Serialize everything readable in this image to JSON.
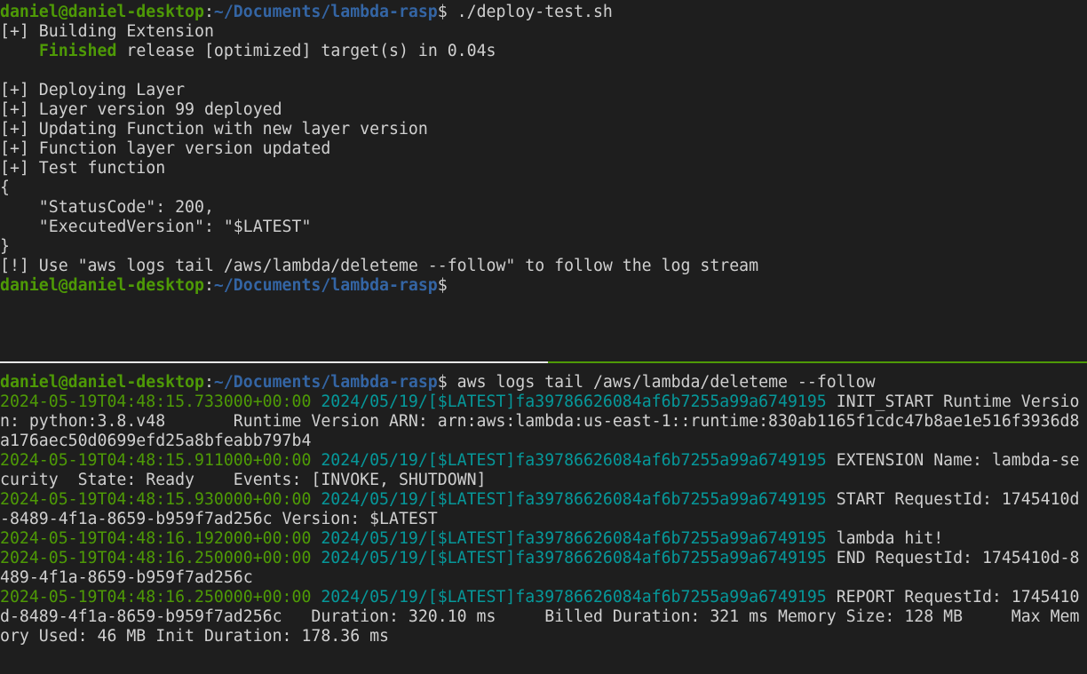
{
  "colors": {
    "background": "#1e1e1e",
    "foreground": "#d0d0d0",
    "prompt_user": "#4e9a06",
    "prompt_path": "#3465a4",
    "timestamp": "#4e9a06",
    "log_stream": "#06989a",
    "divider_inactive": "#e6e6e6",
    "divider_active": "#4e9a06"
  },
  "top": {
    "prompt_user": "daniel@daniel-desktop",
    "prompt_sep": ":",
    "prompt_path": "~/Documents/lambda-rasp",
    "prompt_dollar": "$ ",
    "command": "./deploy-test.sh",
    "l1": "[+] Building Extension",
    "finished_indent": "    ",
    "finished_word": "Finished",
    "finished_rest": " release [optimized] target(s) in 0.04s",
    "l3": "",
    "l4": "[+] Deploying Layer",
    "l5": "[+] Layer version 99 deployed",
    "l6": "[+] Updating Function with new layer version",
    "l7": "[+] Function layer version updated",
    "l8": "[+] Test function",
    "l9": "{",
    "l10": "    \"StatusCode\": 200,",
    "l11": "    \"ExecutedVersion\": \"$LATEST\"",
    "l12": "}",
    "l13": "[!] Use \"aws logs tail /aws/lambda/deleteme --follow\" to follow the log stream",
    "prompt2_dollar": "$"
  },
  "bottom": {
    "prompt_user": "daniel@daniel-desktop",
    "prompt_sep": ":",
    "prompt_path": "~/Documents/lambda-rasp",
    "prompt_dollar": "$ ",
    "command": "aws logs tail /aws/lambda/deleteme --follow",
    "stream": "2024/05/19/[$LATEST]fa39786626084af6b7255a99a6749195",
    "logs": [
      {
        "ts": "2024-05-19T04:48:15.733000+00:00",
        "msg_first": " INIT_START Runtime Versio",
        "cont": [
          "n: python:3.8.v48       Runtime Version ARN: arn:aws:lambda:us-east-1::runtime:830ab1165f1cdc47b8ae1e516f3936d8",
          "a176aec50d0699efd25a8bfeabb797b4"
        ]
      },
      {
        "ts": "2024-05-19T04:48:15.911000+00:00",
        "msg_first": " EXTENSION Name: lambda-se",
        "cont": [
          "curity  State: Ready    Events: [INVOKE, SHUTDOWN]"
        ]
      },
      {
        "ts": "2024-05-19T04:48:15.930000+00:00",
        "msg_first": " START RequestId: 1745410d",
        "cont": [
          "-8489-4f1a-8659-b959f7ad256c Version: $LATEST"
        ]
      },
      {
        "ts": "2024-05-19T04:48:16.192000+00:00",
        "msg_first": " lambda hit!",
        "cont": []
      },
      {
        "ts": "2024-05-19T04:48:16.250000+00:00",
        "msg_first": " END RequestId: 1745410d-8",
        "cont": [
          "489-4f1a-8659-b959f7ad256c"
        ]
      },
      {
        "ts": "2024-05-19T04:48:16.250000+00:00",
        "msg_first": " REPORT RequestId: 1745410",
        "cont": [
          "d-8489-4f1a-8659-b959f7ad256c   Duration: 320.10 ms     Billed Duration: 321 ms Memory Size: 128 MB     Max Mem",
          "ory Used: 46 MB Init Duration: 178.36 ms"
        ]
      }
    ]
  }
}
